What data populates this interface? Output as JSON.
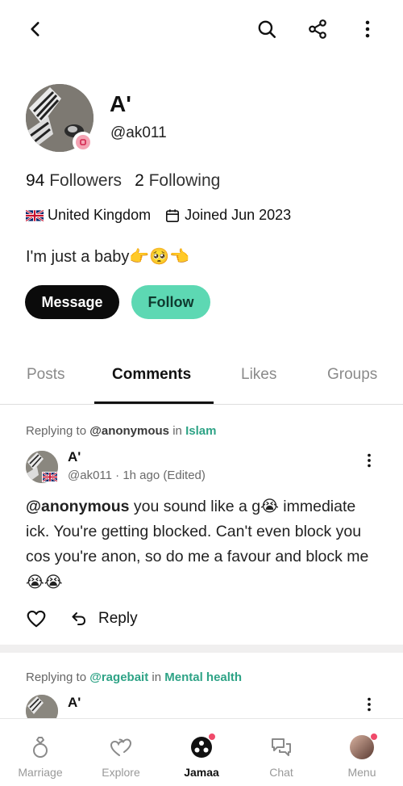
{
  "topbar": {
    "back_icon": "chevron-left-icon",
    "search_icon": "search-icon",
    "share_icon": "share-icon",
    "more_icon": "more-vertical-icon"
  },
  "profile": {
    "display_name": "A'",
    "handle": "@ak011",
    "followers_count": "94",
    "followers_label": "Followers",
    "following_count": "2",
    "following_label": "Following",
    "location": "United Kingdom",
    "joined": "Joined Jun 2023",
    "bio_text": "I'm just a baby",
    "bio_emoji": "👉🥺👈",
    "message_button": "Message",
    "follow_button": "Follow"
  },
  "tabs": [
    {
      "label": "Posts"
    },
    {
      "label": "Comments"
    },
    {
      "label": "Likes"
    },
    {
      "label": "Groups"
    }
  ],
  "comments": [
    {
      "replying_prefix": "Replying to",
      "replying_user": "@anonymous",
      "replying_in": "in",
      "group": "Islam",
      "author": "A'",
      "meta": "@ak011 · 1h ago (Edited)",
      "mention": "@anonymous",
      "body_1": " you sound like a g",
      "emoji_1": "😭",
      "body_2": " immediate ick. You're getting blocked. Can't even block you cos you're anon, so do me a favour and block me ",
      "emoji_2": "😭😭",
      "reply_label": "Reply"
    },
    {
      "replying_prefix": "Replying to",
      "replying_user": "@ragebait",
      "replying_in": "in",
      "group": "Mental health",
      "author": "A'"
    }
  ],
  "bottom_nav": [
    {
      "label": "Marriage",
      "icon": "ring-icon"
    },
    {
      "label": "Explore",
      "icon": "hearts-icon"
    },
    {
      "label": "Jamaa",
      "icon": "jamaa-icon"
    },
    {
      "label": "Chat",
      "icon": "chat-bubbles-icon"
    },
    {
      "label": "Menu",
      "icon": "profile-avatar"
    }
  ],
  "colors": {
    "accent_green": "#5dd8b3",
    "group_link": "#2ea386",
    "notification_dot": "#f04a6a"
  }
}
